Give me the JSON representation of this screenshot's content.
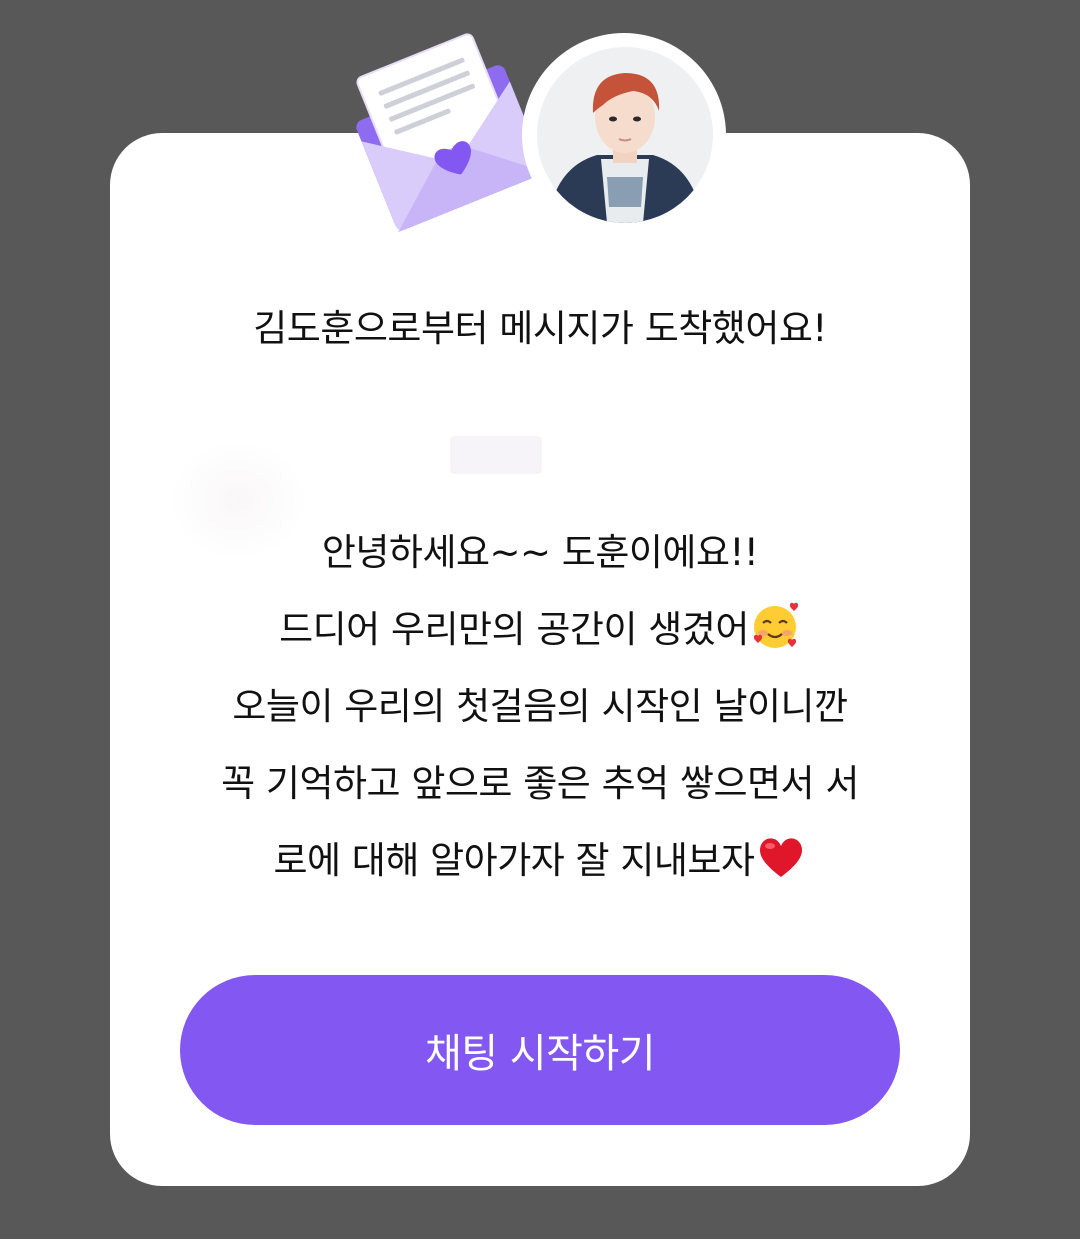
{
  "dialog": {
    "title": "김도훈으로부터 메시지가 도착했어요!",
    "message_lines": [
      "안녕하세요~~ 도훈이에요!!",
      "드디어 우리만의 공간이 생겼어",
      "오늘이 우리의 첫걸음의 시작인 날이니깐",
      "꼭 기억하고 앞으로 좋은 추억 쌓으면서 서",
      "로에 대해 알아가자 잘 지내보자"
    ],
    "line2_emoji": "smiling-face-with-hearts-icon",
    "line5_emoji": "red-heart-icon",
    "start_button_label": "채팅 시작하기"
  },
  "colors": {
    "overlay": "#585858",
    "card": "#ffffff",
    "accent": "#8257f2",
    "envelope": "#9a7af0"
  },
  "icons": {
    "envelope": "envelope-heart-icon",
    "avatar": "profile-avatar"
  }
}
